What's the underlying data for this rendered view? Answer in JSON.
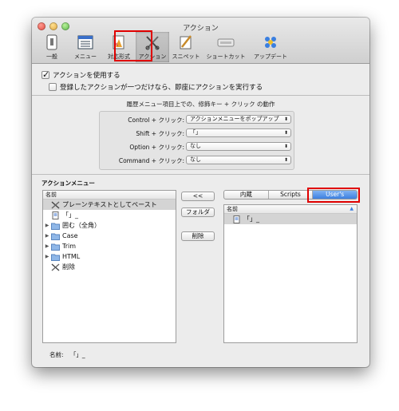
{
  "window": {
    "title": "アクション"
  },
  "toolbar": {
    "items": [
      {
        "label": "一般",
        "icon": "general-icon"
      },
      {
        "label": "メニュー",
        "icon": "menu-icon"
      },
      {
        "label": "対応形式",
        "icon": "formats-icon"
      },
      {
        "label": "アクション",
        "icon": "actions-icon",
        "selected": true
      },
      {
        "label": "スニペット",
        "icon": "snippets-icon"
      },
      {
        "label": "ショートカット",
        "icon": "shortcut-icon"
      },
      {
        "label": "アップデート",
        "icon": "update-icon"
      }
    ]
  },
  "options": {
    "use_actions": "アクションを使用する",
    "use_actions_checked": true,
    "execute_single": "登録したアクションが一つだけなら、即座にアクションを実行する",
    "execute_single_checked": false
  },
  "modifiers": {
    "title": "履歴メニュー項目上での、修飾キー + クリック の動作",
    "rows": [
      {
        "label": "Control + クリック:",
        "value": "アクションメニューをポップアップ"
      },
      {
        "label": "Shift + クリック:",
        "value": "「」"
      },
      {
        "label": "Option + クリック:",
        "value": "なし"
      },
      {
        "label": "Command + クリック:",
        "value": "なし"
      }
    ]
  },
  "action_menu": {
    "title": "アクションメニュー",
    "left_header": "名前",
    "left_items": [
      {
        "label": "プレーンテキストとしてペースト",
        "icon": "scissors-icon",
        "expandable": false,
        "selected": true
      },
      {
        "label": "「」_",
        "icon": "document-icon",
        "expandable": false
      },
      {
        "label": "囲む（全角）",
        "icon": "folder-icon",
        "expandable": true
      },
      {
        "label": "Case",
        "icon": "folder-icon",
        "expandable": true
      },
      {
        "label": "Trim",
        "icon": "folder-icon",
        "expandable": true
      },
      {
        "label": "HTML",
        "icon": "folder-icon",
        "expandable": true
      },
      {
        "label": "削除",
        "icon": "scissors-icon",
        "expandable": false
      }
    ],
    "buttons": {
      "move_left": "<<",
      "folder": "フォルダ",
      "delete": "削除"
    },
    "segments": [
      "内蔵",
      "Scripts",
      "User's"
    ],
    "selected_segment": 2,
    "right_header": "名前",
    "right_items": [
      {
        "label": "「」_",
        "icon": "document-icon",
        "selected": true
      }
    ],
    "name_label": "名前:",
    "name_value": "「」_"
  },
  "colors": {
    "highlight_box": "#e00000",
    "segment_selected": "#3c7fe0"
  }
}
